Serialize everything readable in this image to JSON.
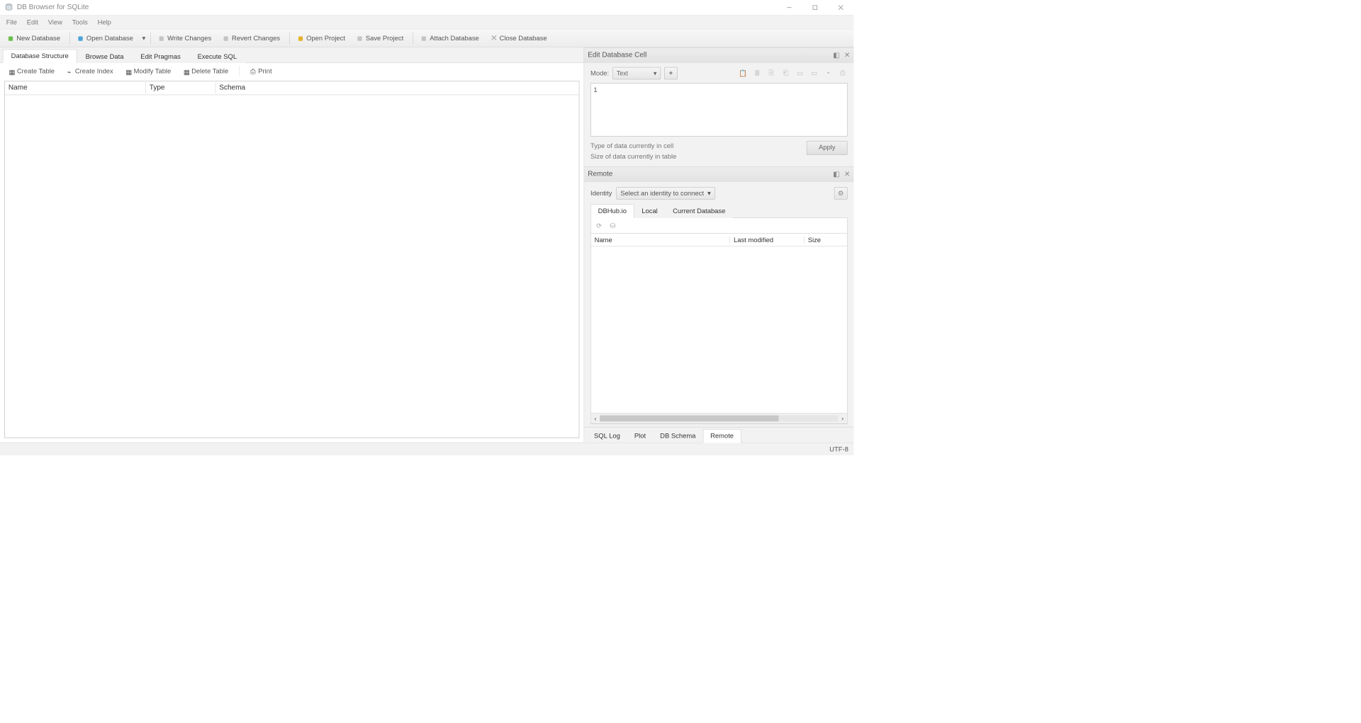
{
  "titlebar": {
    "title": "DB Browser for SQLite"
  },
  "menu": {
    "items": [
      "File",
      "Edit",
      "View",
      "Tools",
      "Help"
    ]
  },
  "toolbar": {
    "new_db": "New Database",
    "open_db": "Open Database",
    "write_changes": "Write Changes",
    "revert_changes": "Revert Changes",
    "open_project": "Open Project",
    "save_project": "Save Project",
    "attach_db": "Attach Database",
    "close_db": "Close Database"
  },
  "main_tabs": {
    "structure": "Database Structure",
    "browse": "Browse Data",
    "pragmas": "Edit Pragmas",
    "sql": "Execute SQL"
  },
  "structure_toolbar": {
    "create_table": "Create Table",
    "create_index": "Create Index",
    "modify_table": "Modify Table",
    "delete_table": "Delete Table",
    "print": "Print"
  },
  "structure_table": {
    "cols": {
      "name": "Name",
      "type": "Type",
      "schema": "Schema"
    }
  },
  "edit_cell_panel": {
    "title": "Edit Database Cell",
    "mode_label": "Mode:",
    "mode_value": "Text",
    "editor_value": "1",
    "info_type": "Type of data currently in cell",
    "info_size": "Size of data currently in table",
    "apply": "Apply"
  },
  "remote_panel": {
    "title": "Remote",
    "identity_label": "Identity",
    "identity_value": "Select an identity to connect",
    "tabs": {
      "dbhub": "DBHub.io",
      "local": "Local",
      "current": "Current Database"
    },
    "table_cols": {
      "name": "Name",
      "last_modified": "Last modified",
      "size": "Size"
    }
  },
  "bottom_tabs": {
    "sql_log": "SQL Log",
    "plot": "Plot",
    "db_schema": "DB Schema",
    "remote": "Remote"
  },
  "statusbar": {
    "encoding": "UTF-8"
  }
}
